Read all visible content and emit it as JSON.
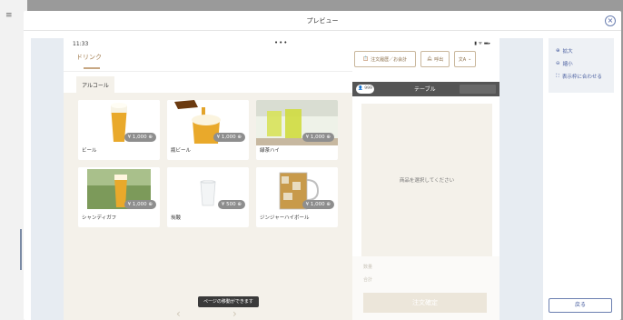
{
  "modal": {
    "title": "プレビュー"
  },
  "status": {
    "time": "11:33",
    "dots": "•••",
    "icons": "▮ ᯤ ▬▸"
  },
  "category_tab": "ドリンク",
  "top_buttons": [
    {
      "label": "注文履歴／お会計",
      "icon": "📋"
    },
    {
      "label": "呼出",
      "icon": "🛎"
    },
    {
      "label": "⌄",
      "icon": "文A"
    }
  ],
  "sub_tab": "アルコール",
  "menu_items": [
    {
      "name": "ビール",
      "price": "¥ 1,000 ⊕"
    },
    {
      "name": "瓶ビール",
      "price": "¥ 1,000 ⊕"
    },
    {
      "name": "緑茶ハイ",
      "price": "¥ 1,000 ⊕"
    },
    {
      "name": "シャンディガフ",
      "price": "¥ 1,000 ⊕"
    },
    {
      "name": "炭酸",
      "price": "¥ 500 ⊕"
    },
    {
      "name": "ジンジャーハイボール",
      "price": "¥ 1,000 ⊕"
    }
  ],
  "pager": {
    "tip": "ページの移動ができます",
    "prev": "‹",
    "next": "›"
  },
  "table_bar": {
    "people": "👤 999",
    "label": "テーブル",
    "right_btn": ""
  },
  "order": {
    "placeholder": "商品を選択してください",
    "subtotal_label": "数量",
    "total_label": "合計",
    "confirm": "注文確定"
  },
  "side_panel": {
    "zoom_in": "拡大",
    "zoom_out": "縮小",
    "fit": "表示枠に合わせる",
    "back": "戻る"
  }
}
